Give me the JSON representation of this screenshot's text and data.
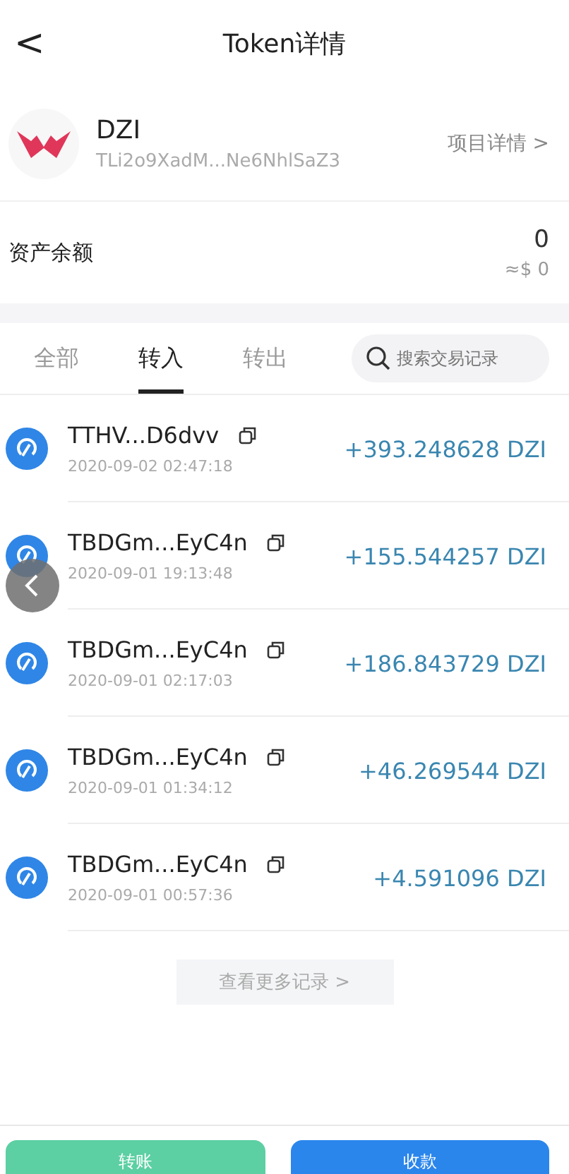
{
  "header": {
    "back": "<",
    "title": "Token详情"
  },
  "token": {
    "symbol": "DZI",
    "address": "TLi2o9XadM...Ne6NhlSaZ3",
    "details_link": "项目详情",
    "details_arrow": ">"
  },
  "balance": {
    "label": "资产余额",
    "amount": "0",
    "fiat": "≈$ 0"
  },
  "tabs": [
    {
      "label": "全部",
      "selected": false
    },
    {
      "label": "转入",
      "selected": true
    },
    {
      "label": "转出",
      "selected": false
    }
  ],
  "search": {
    "placeholder": "搜索交易记录"
  },
  "transactions": [
    {
      "address": "TTHV...D6dvv",
      "time": "2020-09-02 02:47:18",
      "amount": "+393.248628 DZI"
    },
    {
      "address": "TBDGm...EyC4n",
      "time": "2020-09-01 19:13:48",
      "amount": "+155.544257 DZI"
    },
    {
      "address": "TBDGm...EyC4n",
      "time": "2020-09-01 02:17:03",
      "amount": "+186.843729 DZI"
    },
    {
      "address": "TBDGm...EyC4n",
      "time": "2020-09-01 01:34:12",
      "amount": "+46.269544 DZI"
    },
    {
      "address": "TBDGm...EyC4n",
      "time": "2020-09-01 00:57:36",
      "amount": "+4.591096 DZI"
    }
  ],
  "more": {
    "label": "查看更多记录",
    "arrow": ">"
  },
  "actions": [
    "转账",
    "收款"
  ]
}
